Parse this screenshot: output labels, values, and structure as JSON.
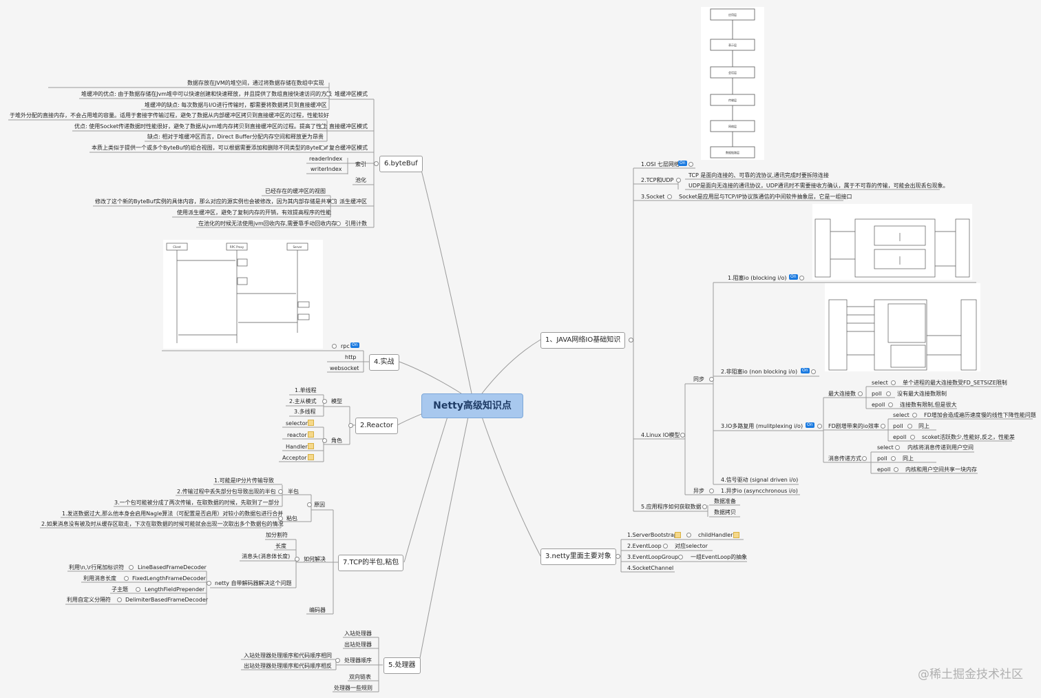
{
  "root": "Netty高级知识点",
  "branches": {
    "bytebuf": {
      "label": "6.byteBuf",
      "heap": {
        "label": "堆缓冲区模式",
        "items": [
          "数据存放在JVM的堆空间，通过将数据存储在数组中实现",
          "堆缓冲的优点: 由于数据存储在Jvm堆中可以快速创建和快速释放，并且提供了数组直接快速访问的方法",
          "堆缓冲的缺点: 每次数据与I/O进行传输时，都需要将数据拷贝到直接缓冲区"
        ]
      },
      "direct": {
        "label": "直接缓冲区模式",
        "items": [
          "于堆外分配的直接内存，不会占用堆的容量。适用于套接字传输过程，避免了数据从内部缓冲区拷贝到直接缓冲区的过程，性能较好",
          "优点: 使用Socket传递数据时性能很好，避免了数据从Jvm堆内存拷贝到直接缓冲区的过程。提高了性能",
          "缺点: 相对于堆缓冲区而言，Direct Buffer分配内存空间和释放更为昂贵"
        ]
      },
      "composite": {
        "label": "复合缓冲区模式",
        "items": [
          "本质上类似于提供一个或多个ByteBuf的组合视图，可以根据需要添加和删除不同类型的ByteBuf"
        ]
      },
      "index": {
        "label": "索引",
        "items": [
          "readerIndex",
          "writerIndex"
        ]
      },
      "pool": "池化",
      "derived": {
        "label": "派生缓冲区",
        "items": [
          "已经存在的缓冲区的视图",
          "修改了这个新的ByteBuf实例的具体内容，那么对应的源实例也会被修改，因为其内部存储是共享的",
          "使用派生缓冲区，避免了复制内存的开销，有效提高程序的性能"
        ]
      },
      "refcount": {
        "label": "引用计数",
        "items": [
          "在池化的时候无法使用jvm回收内存,需要靠手动回收内存"
        ]
      }
    },
    "practice": {
      "label": "4.实战",
      "items": [
        "rpc",
        "http",
        "websocket"
      ],
      "seq_diagram": {
        "actors": [
          "Client",
          "RPC Proxy",
          "Server"
        ]
      }
    },
    "reactor": {
      "label": "2.Reactor",
      "model": {
        "label": "模型",
        "items": [
          "1.单线程",
          "2.主从模式",
          "3.多线程"
        ]
      },
      "role": {
        "label": "角色",
        "items": [
          "selector",
          "reactor",
          "Handler",
          "Acceptor"
        ]
      }
    },
    "tcp": {
      "label": "7.TCP的半包,粘包",
      "cause": {
        "label": "原因",
        "half": {
          "label": "半包",
          "items": [
            "1.可能是IP分片传输导致",
            "2.传输过程中丢失部分包导致出现的半包",
            "3.一个包可能被分成了两次传输，在取数据的时候，先取到了一部分"
          ]
        },
        "stick": {
          "label": "粘包",
          "items": [
            "1.发送数据过大,那么他本身会启用Nagle算法（可配置是否启用）对较小的数据包进行合并",
            "2.如果消息没有被及时从缓存区取走，下次在取数据的时候可能就会出现一次取出多个数据包的情况"
          ]
        }
      },
      "solve": {
        "label": "如何解决",
        "items": [
          "加分割符",
          "长度",
          "消息头(消息体长度)"
        ],
        "netty": {
          "label": "netty 自带解码器解决这个问题",
          "rows": [
            [
              "利用\\n,\\r行尾加标识符",
              "LineBasedFrameDecoder"
            ],
            [
              "利用消息长度",
              "FixedLengthFrameDecoder"
            ],
            [
              "子主题",
              "LengthFieldPrepender"
            ],
            [
              "利用自定义分隔符",
              "DelimiterBasedFrameDecoder"
            ]
          ]
        }
      },
      "codec": "编码器"
    },
    "handler": {
      "label": "5.处理器",
      "items": [
        "入站处理器",
        "出站处理器"
      ],
      "order": {
        "label": "处理器顺序",
        "items": [
          "入站处理器处理顺序和代码顺序相同",
          "出站处理器处理顺序和代码顺序相反"
        ]
      },
      "tail": [
        "双向链表",
        "处理器一些规则"
      ]
    },
    "javaio": {
      "label": "1、JAVA网络IO基础知识",
      "osi": {
        "label": "1.OSI 七层网络",
        "layers": [
          "应用层",
          "表示层",
          "会话层",
          "传输层",
          "网络层",
          "数据链路层"
        ]
      },
      "tcpudp": {
        "label": "2.TCP和UDP",
        "items": [
          "TCP 是面向连接的、可靠的流协议,通讯完成时要拆除连接",
          "UDP是面向无连接的通讯协议，UDP通讯时不需要接收方确认，属于不可靠的传输，可能会出现丢包现象。"
        ]
      },
      "socket": {
        "label": "3.Socket",
        "items": [
          "Socket是应用层与TCP/IP协议族通信的中间软件抽象层，它是一组接口"
        ]
      },
      "linux": {
        "label": "4.Linux IO模型",
        "sync": "同步",
        "async": "异步",
        "blocking": "1.阻塞io    (blocking i/o)",
        "nonblocking": "2.非阻塞io    (non blocking i/o)",
        "multiplex": "3.IO多路复用     (mulitplexing i/o)",
        "signal": "4.信号驱动    (signal driven i/o)",
        "asyncio": "1.异步io     (asyncchronous i/o)",
        "maxconn": {
          "label": "最大连接数",
          "rows": [
            [
              "select",
              "单个进程的最大连接数受FD_SETSIZE限制"
            ],
            [
              "poll",
              "没有最大连接数限制"
            ],
            [
              "epoll",
              "连接数有限制,但是很大"
            ]
          ]
        },
        "fdeff": {
          "label": "FD剧增带来的io效率",
          "rows": [
            [
              "select",
              "FD增加会造成遍历速度慢的线性下降性能问题"
            ],
            [
              "poll",
              "同上"
            ],
            [
              "epoll",
              "scoket活跃数少,性能好,反之，性能差"
            ]
          ]
        },
        "msgpass": {
          "label": "消息传递方式",
          "rows": [
            [
              "select",
              "内核将消息传递到用户空间"
            ],
            [
              "poll",
              "同上"
            ],
            [
              "epoll",
              "内核和用户空间共享一块内存"
            ]
          ]
        }
      },
      "fetch": {
        "label": "5.应用程序如何获取数据",
        "items": [
          "数据准备",
          "数据拷贝"
        ]
      },
      "on_tag": "On"
    },
    "nettyobj": {
      "label": "3.netty里面主要对象",
      "rows": [
        [
          "1.ServerBootstrap",
          "childHandler"
        ],
        [
          "2.EventLoop",
          "对应selector"
        ],
        [
          "3.EventLoopGroup",
          "一组EventLoop的抽象"
        ],
        [
          "4.SocketChannel",
          ""
        ]
      ]
    }
  },
  "watermark": "@稀土掘金技术社区",
  "colors": {
    "root_fill": "#a8c8ee",
    "line": "#9a9a9a",
    "on_tag": "#1a7ae0"
  }
}
